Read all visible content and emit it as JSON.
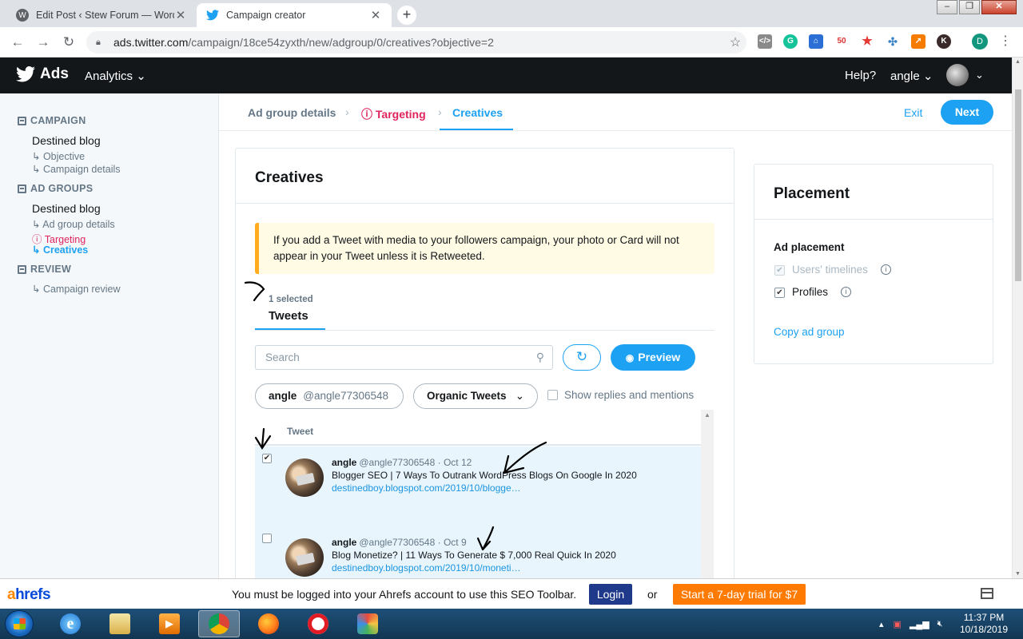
{
  "browser": {
    "tabs": [
      {
        "title": "Edit Post ‹ Stew Forum — WordPress",
        "icon": "wordpress-icon"
      },
      {
        "title": "Campaign creator",
        "icon": "twitter-icon"
      }
    ],
    "url_host": "ads.twitter.com",
    "url_path": "/campaign/18ce54zyxth/new/adgroup/0/creatives?objective=2",
    "profile_initial": "D"
  },
  "header": {
    "brand": "Ads",
    "analytics": "Analytics",
    "help": "Help?",
    "user": "angle"
  },
  "sidebar": {
    "campaign": {
      "section": "CAMPAIGN",
      "name": "Destined blog",
      "items": [
        "↳ Objective",
        "↳ Campaign details"
      ]
    },
    "ad_groups": {
      "section": "AD GROUPS",
      "name": "Destined blog",
      "items": [
        "↳ Ad group details",
        "Targeting",
        "↳ Creatives"
      ]
    },
    "review": {
      "section": "REVIEW",
      "items": [
        "↳ Campaign review"
      ]
    }
  },
  "steps": {
    "ad_group_details": "Ad group details",
    "targeting": "Targeting",
    "creatives": "Creatives",
    "exit": "Exit",
    "next": "Next"
  },
  "creatives": {
    "title": "Creatives",
    "notice": "If you add a Tweet with media to your followers campaign, your photo or Card will not appear in your Tweet unless it is Retweeted.",
    "selected_count": "1 selected",
    "tab": "Tweets",
    "search_placeholder": "Search",
    "preview": "Preview",
    "account_name": "angle",
    "account_handle": "@angle77306548",
    "tweet_filter": "Organic Tweets",
    "show_replies": "Show replies and mentions",
    "column_header": "Tweet",
    "tweets": [
      {
        "checked": true,
        "name": "angle",
        "handle_date": "@angle77306548 · Oct 12",
        "text": "Blogger SEO | 7 Ways To Outrank WordPress Blogs On Google In 2020",
        "link": "destinedboy.blogspot.com/2019/10/blogge…"
      },
      {
        "checked": false,
        "name": "angle",
        "handle_date": "@angle77306548 · Oct 9",
        "text": "Blog Monetize? | 11 Ways To Generate $ 7,000 Real Quick In 2020",
        "link": "destinedboy.blogspot.com/2019/10/moneti…"
      }
    ]
  },
  "placement": {
    "title": "Placement",
    "label": "Ad placement",
    "options": [
      {
        "label": "Users' timelines",
        "checked": true,
        "disabled": true
      },
      {
        "label": "Profiles",
        "checked": true,
        "disabled": false
      }
    ],
    "copy": "Copy ad group"
  },
  "ahrefs": {
    "logo_a": "a",
    "logo_rest": "hrefs",
    "message": "You must be logged into your Ahrefs account to use this SEO Toolbar.",
    "login": "Login",
    "or": "or",
    "trial": "Start a 7-day trial for $7"
  },
  "taskbar": {
    "time": "11:37 PM",
    "date": "10/18/2019",
    "apps": [
      "internet-explorer-icon",
      "file-explorer-icon",
      "media-player-icon",
      "chrome-icon",
      "firefox-icon",
      "opera-icon",
      "paint-icon"
    ]
  },
  "colors": {
    "accent": "#1da1f2",
    "warning": "#e0245e",
    "header_bg": "#14171a"
  }
}
